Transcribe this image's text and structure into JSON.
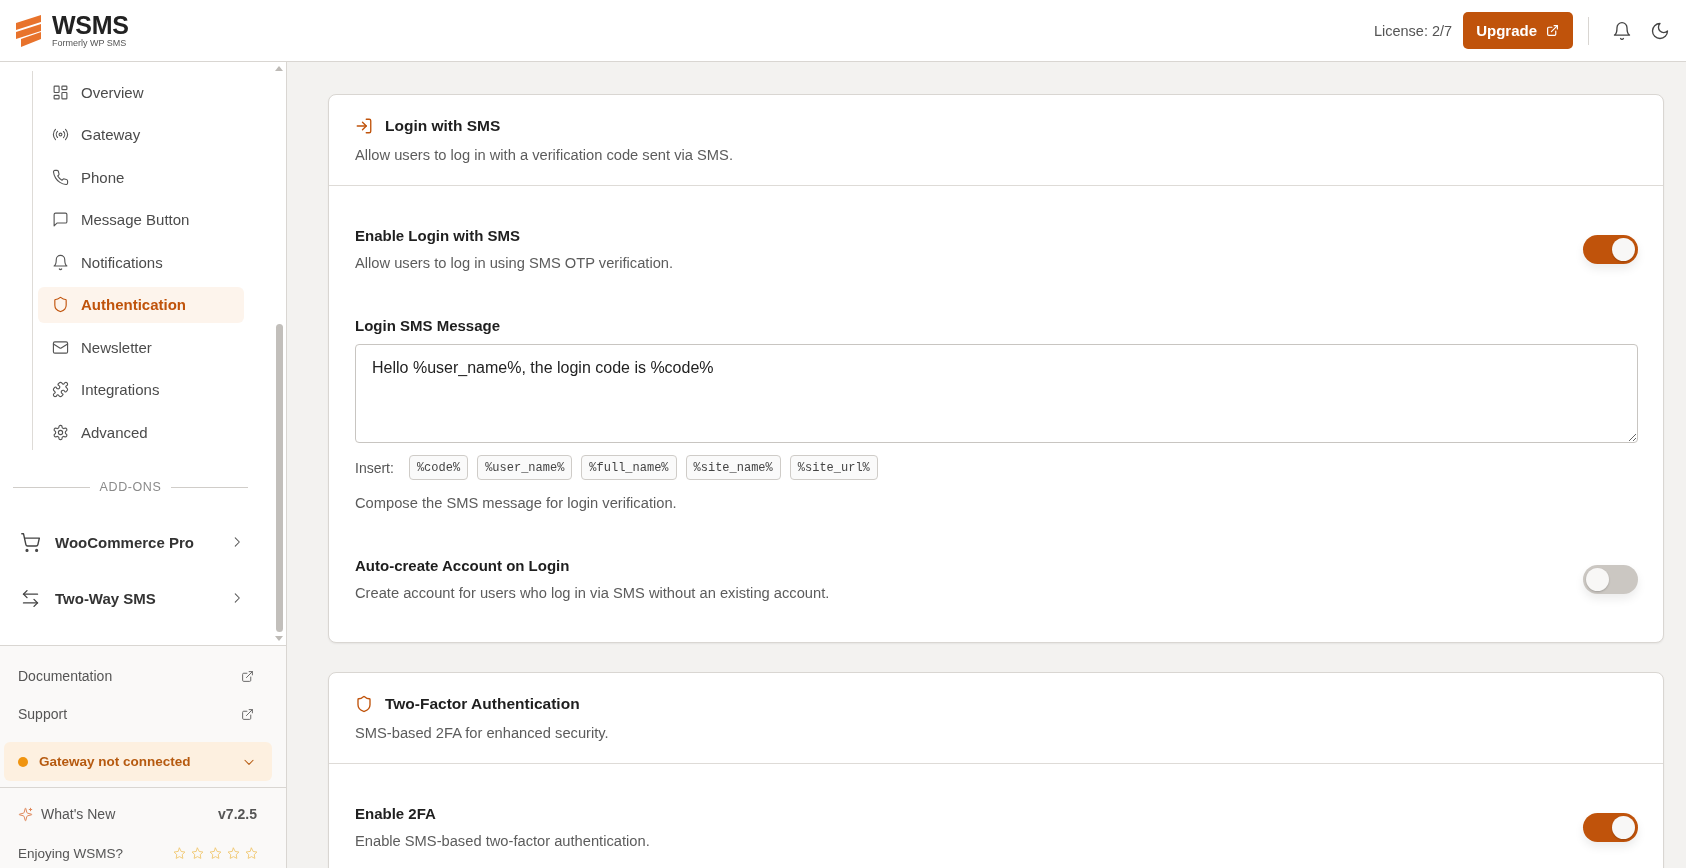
{
  "header": {
    "logo": {
      "name": "WSMS",
      "tagline": "Formerly WP SMS"
    },
    "license": "License: 2/7",
    "upgrade_button": "Upgrade"
  },
  "sidebar": {
    "nav_items": [
      {
        "label": "Overview",
        "selected": false
      },
      {
        "label": "Gateway",
        "selected": false
      },
      {
        "label": "Phone",
        "selected": false
      },
      {
        "label": "Message Button",
        "selected": false
      },
      {
        "label": "Notifications",
        "selected": false
      },
      {
        "label": "Authentication",
        "selected": true
      },
      {
        "label": "Newsletter",
        "selected": false
      },
      {
        "label": "Integrations",
        "selected": false
      },
      {
        "label": "Advanced",
        "selected": false
      }
    ],
    "addons": {
      "heading": "ADD-ONS",
      "items": [
        {
          "label": "WooCommerce Pro",
          "expanded": false
        },
        {
          "label": "Two-Way SMS",
          "expanded": false
        }
      ]
    },
    "links": [
      {
        "label": "Documentation"
      },
      {
        "label": "Support"
      }
    ],
    "gateway_status": {
      "label": "Gateway not connected",
      "connected": false,
      "expanded": false
    },
    "whats_new": {
      "label": "What's New",
      "version": "v7.2.5"
    },
    "rating": {
      "label": "Enjoying WSMS?",
      "stars": 0
    }
  },
  "cards": [
    {
      "title": "Login with SMS",
      "description": "Allow users to log in with a verification code sent via SMS.",
      "settings": [
        {
          "kind": "toggle",
          "title": "Enable Login with SMS",
          "description": "Allow users to log in using SMS OTP verification.",
          "on": true
        },
        {
          "kind": "textarea",
          "title": "Login SMS Message",
          "value": "Hello %user_name%, the login code is %code%",
          "insert_label": "Insert:",
          "tokens": [
            "%code%",
            "%user_name%",
            "%full_name%",
            "%site_name%",
            "%site_url%"
          ],
          "help": "Compose the SMS message for login verification."
        },
        {
          "kind": "toggle",
          "title": "Auto-create Account on Login",
          "description": "Create account for users who log in via SMS without an existing account.",
          "on": false
        }
      ]
    },
    {
      "title": "Two-Factor Authentication",
      "description": "SMS-based 2FA for enhanced security.",
      "settings": [
        {
          "kind": "toggle",
          "title": "Enable 2FA",
          "description": "Enable SMS-based two-factor authentication.",
          "on": true
        }
      ]
    }
  ]
}
